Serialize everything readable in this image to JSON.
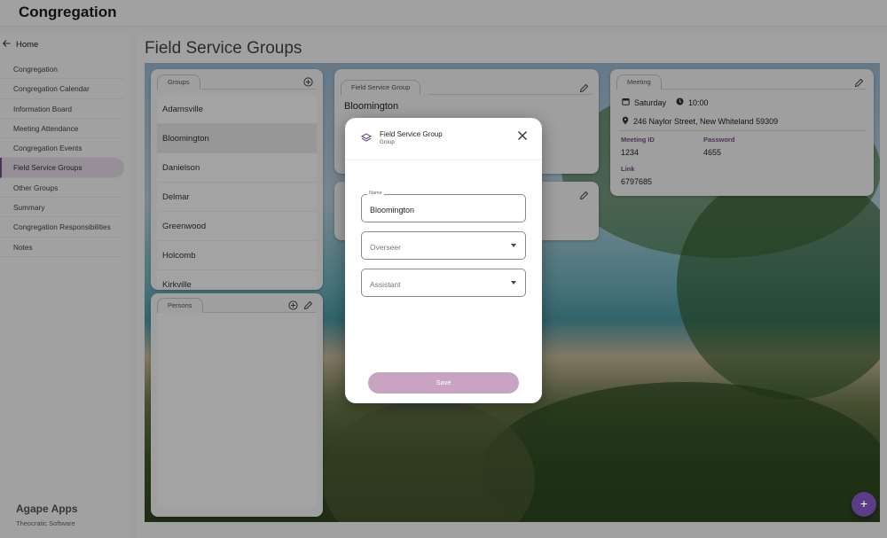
{
  "app": {
    "title": "Congregation"
  },
  "sidebar": {
    "home_label": "Home",
    "items": [
      {
        "label": "Congregation"
      },
      {
        "label": "Congregation Calendar"
      },
      {
        "label": "Information Board"
      },
      {
        "label": "Meeting Attendance"
      },
      {
        "label": "Congregation Events"
      },
      {
        "label": "Field Service Groups",
        "active": true
      },
      {
        "label": "Other Groups"
      },
      {
        "label": "Summary"
      },
      {
        "label": "Congregation Responsibilities"
      },
      {
        "label": "Notes"
      }
    ],
    "brand": "Agape Apps",
    "brand_sub": "Theocratic Software"
  },
  "page": {
    "title": "Field Service Groups"
  },
  "groups_card": {
    "tab": "Groups",
    "items": [
      "Adamsville",
      "Bloomington",
      "Danielson",
      "Delmar",
      "Greenwood",
      "Holcomb",
      "Kirkville"
    ],
    "selected": "Bloomington"
  },
  "persons_card": {
    "tab": "Persons"
  },
  "fsg_card": {
    "tab": "Field Service Group",
    "name": "Bloomington"
  },
  "meeting_card": {
    "tab": "Meeting",
    "day": "Saturday",
    "time": "10:00",
    "address": "246 Naylor Street, New Whiteland 59309",
    "meeting_id_label": "Meeting ID",
    "meeting_id": "1234",
    "password_label": "Password",
    "password": "4655",
    "link_label": "Link",
    "link": "6797685"
  },
  "dialog": {
    "title": "Field Service Group",
    "subtitle": "Group",
    "name_label": "Name",
    "name_value": "Bloomington",
    "overseer_placeholder": "Overseer",
    "assistant_placeholder": "Assistant",
    "save_label": "Save"
  },
  "colors": {
    "accent": "#7a4e86",
    "save_button": "#c9a4c2",
    "fab": "#5a3d86",
    "active_nav": "#e6dce8"
  }
}
